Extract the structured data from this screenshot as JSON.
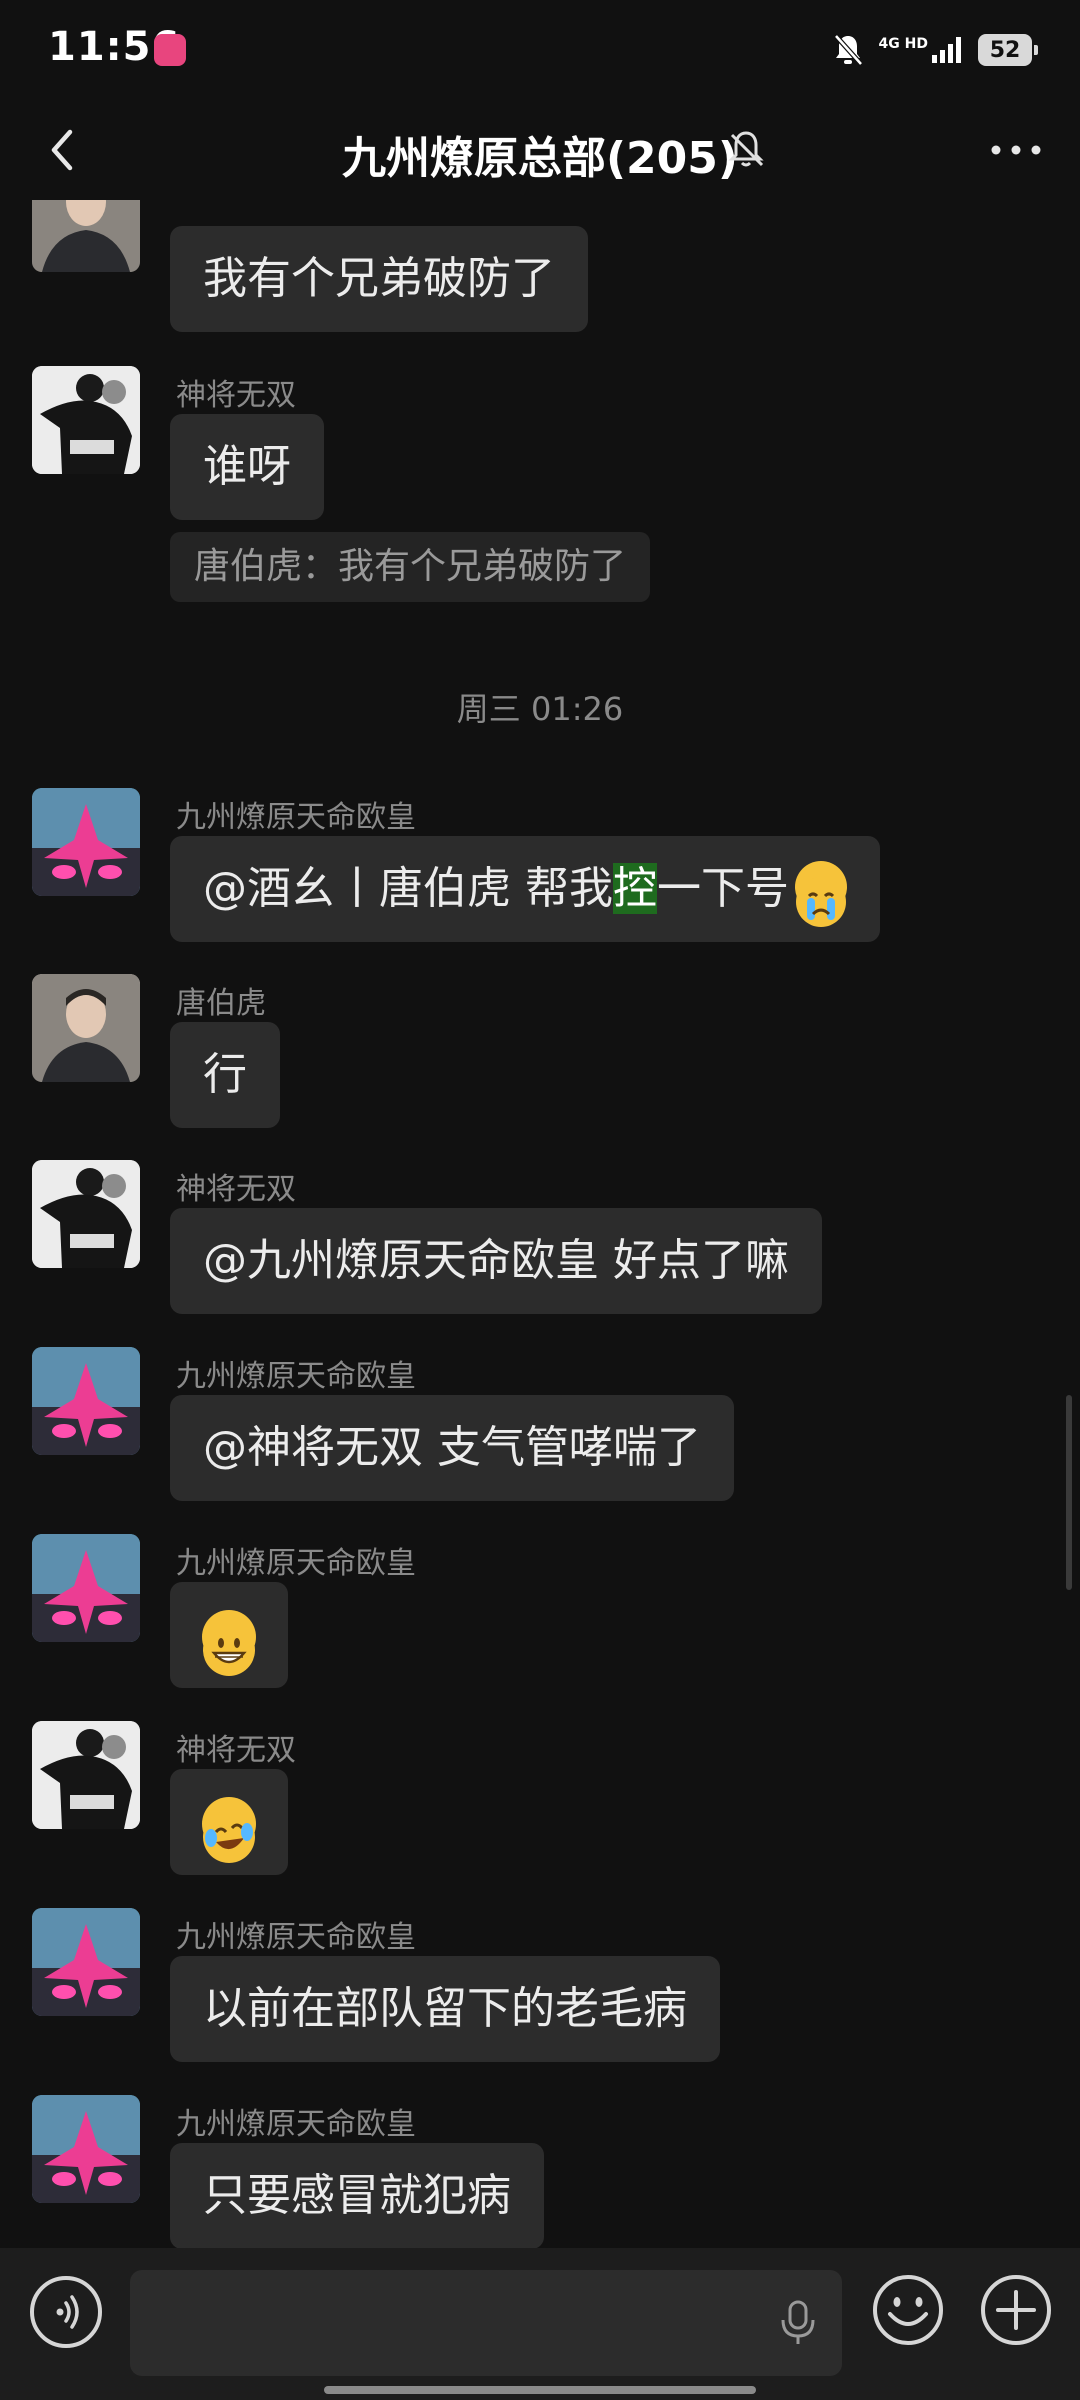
{
  "status_bar": {
    "time": "11:56",
    "network": "4G HD",
    "battery": "52"
  },
  "header": {
    "title": "九州燎原总部(205)"
  },
  "chat": {
    "messages": [
      {
        "sender": "",
        "text": "我有个兄弟破防了",
        "avatar": "realistic-man"
      },
      {
        "sender": "神将无双",
        "text": "谁呀",
        "avatar": "bw-figure",
        "quote": "唐伯虎：我有个兄弟破防了"
      },
      {
        "sender": "九州燎原天命欧皇",
        "text_before": "@酒幺丨唐伯虎  帮我",
        "text_highlight": "控",
        "text_after": "一下号",
        "emoji": "crying-face",
        "avatar": "pink-star"
      },
      {
        "sender": "唐伯虎",
        "text": "行",
        "avatar": "realistic-man"
      },
      {
        "sender": "神将无双",
        "text": "@九州燎原天命欧皇  好点了嘛",
        "avatar": "bw-figure"
      },
      {
        "sender": "九州燎原天命欧皇",
        "text": "@神将无双  支气管哮喘了",
        "avatar": "pink-star"
      },
      {
        "sender": "九州燎原天命欧皇",
        "emoji": "grinning-face",
        "avatar": "pink-star"
      },
      {
        "sender": "神将无双",
        "emoji": "laughing-tears-face",
        "avatar": "bw-figure"
      },
      {
        "sender": "九州燎原天命欧皇",
        "text": "以前在部队留下的老毛病",
        "avatar": "pink-star"
      },
      {
        "sender": "九州燎原天命欧皇",
        "text": "只要感冒就犯病",
        "avatar": "pink-star"
      }
    ],
    "timestamp": "周三 01:26"
  },
  "input_bar": {
    "placeholder": ""
  },
  "colors": {
    "background": "#111111",
    "bubble": "#2c2c2c",
    "highlight": "#1e6b1e",
    "muted_text": "#8a8a8a"
  }
}
